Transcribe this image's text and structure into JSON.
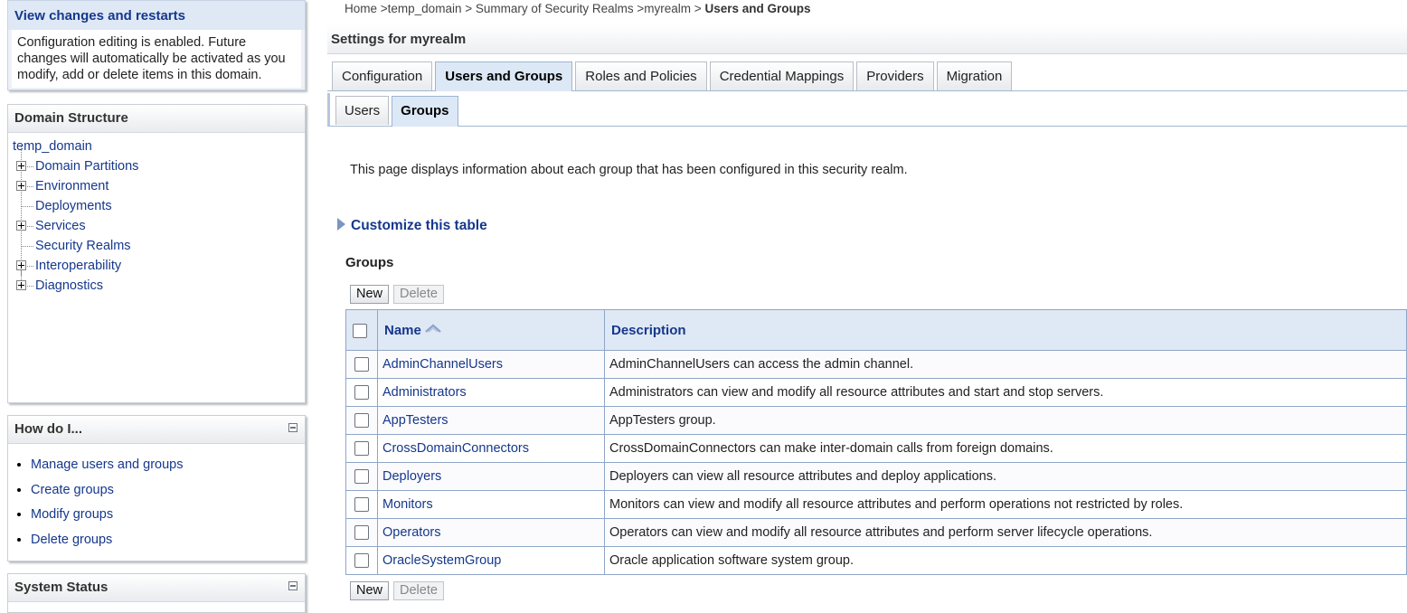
{
  "changes": {
    "title": "View changes and restarts",
    "body": "Configuration editing is enabled. Future changes will automatically be activated as you modify, add or delete items in this domain."
  },
  "domain_structure": {
    "title": "Domain Structure",
    "root": "temp_domain",
    "items": [
      {
        "label": "Domain Partitions"
      },
      {
        "label": "Environment"
      },
      {
        "label": "Deployments"
      },
      {
        "label": "Services"
      },
      {
        "label": "Security Realms"
      },
      {
        "label": "Interoperability"
      },
      {
        "label": "Diagnostics"
      }
    ]
  },
  "howdoi": {
    "title": "How do I...",
    "items": [
      "Manage users and groups",
      "Create groups",
      "Modify groups",
      "Delete groups"
    ]
  },
  "system_status": {
    "title": "System Status"
  },
  "breadcrumb": {
    "home": "Home >",
    "domain": "temp_domain >",
    "summary": "Summary of Security Realms >",
    "realm": "myrealm >",
    "current": "Users and Groups"
  },
  "settings": {
    "title": "Settings for myrealm"
  },
  "tabs": [
    "Configuration",
    "Users and Groups",
    "Roles and Policies",
    "Credential Mappings",
    "Providers",
    "Migration"
  ],
  "subtabs": [
    "Users",
    "Groups"
  ],
  "page": {
    "description": "This page displays information about each group that has been configured in this security realm.",
    "customize": "Customize this table",
    "table_title": "Groups",
    "new_label": "New",
    "delete_label": "Delete"
  },
  "table": {
    "headers": {
      "name": "Name",
      "description": "Description"
    },
    "rows": [
      {
        "name": "AdminChannelUsers",
        "description": "AdminChannelUsers can access the admin channel."
      },
      {
        "name": "Administrators",
        "description": "Administrators can view and modify all resource attributes and start and stop servers."
      },
      {
        "name": "AppTesters",
        "description": "AppTesters group."
      },
      {
        "name": "CrossDomainConnectors",
        "description": "CrossDomainConnectors can make inter-domain calls from foreign domains."
      },
      {
        "name": "Deployers",
        "description": "Deployers can view all resource attributes and deploy applications."
      },
      {
        "name": "Monitors",
        "description": "Monitors can view and modify all resource attributes and perform operations not restricted by roles."
      },
      {
        "name": "Operators",
        "description": "Operators can view and modify all resource attributes and perform server lifecycle operations."
      },
      {
        "name": "OracleSystemGroup",
        "description": "Oracle application software system group."
      }
    ]
  },
  "colors": {
    "link": "#15388c",
    "header_bg": "#dfe8f5",
    "border": "#8fa6c7"
  }
}
